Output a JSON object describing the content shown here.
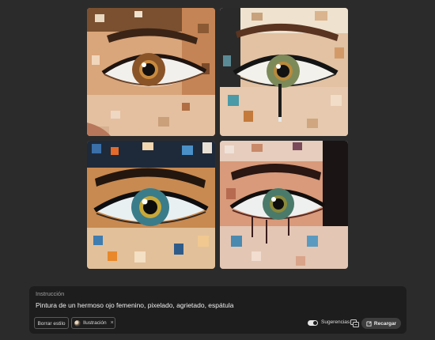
{
  "images": [
    {
      "alt": "eye-painting-1"
    },
    {
      "alt": "eye-painting-2"
    },
    {
      "alt": "eye-painting-3"
    },
    {
      "alt": "eye-painting-4"
    }
  ],
  "prompt": {
    "label": "Instrucción",
    "value": "Pintura de un hermoso ojo femenino, pixelado, agrietado, espátula"
  },
  "buttons": {
    "clear_style": "Borrar estilo",
    "style_chip": "Ilustración",
    "style_chip_remove": "×",
    "suggestions": "Sugerencias",
    "reload": "Recargar"
  },
  "toggles": {
    "suggestions_on": true
  },
  "icons": {
    "suggestions": "suggestions-icon",
    "reload": "reload-icon",
    "remove": "close-icon"
  },
  "colors": {
    "background": "#2b2b2b",
    "panel": "#1d1d1d",
    "reload_button": "#3d3d3d"
  }
}
